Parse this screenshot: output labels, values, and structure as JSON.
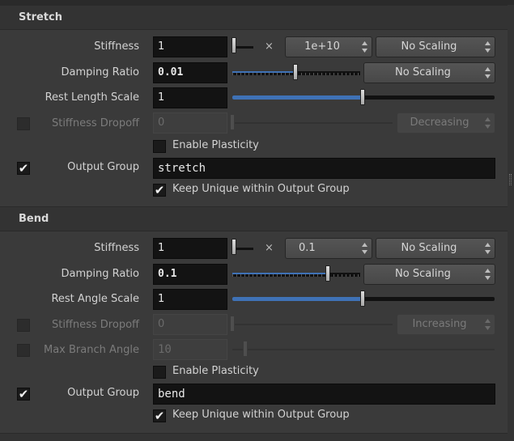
{
  "stretch": {
    "title": "Stretch",
    "stiffness": {
      "label": "Stiffness",
      "value": "1",
      "multiplier_symbol": "×",
      "exponent": "1e+10",
      "scaling": "No Scaling"
    },
    "damping_ratio": {
      "label": "Damping Ratio",
      "value": "0.01",
      "scaling": "No Scaling"
    },
    "rest_length_scale": {
      "label": "Rest Length Scale",
      "value": "1"
    },
    "stiffness_dropoff": {
      "label": "Stiffness Dropoff",
      "value": "0",
      "mode": "Decreasing",
      "enabled": false
    },
    "enable_plasticity": {
      "label": "Enable Plasticity",
      "checked": false
    },
    "output_group": {
      "label": "Output Group",
      "value": "stretch",
      "checked": true
    },
    "keep_unique": {
      "label": "Keep Unique within Output Group",
      "checked": true
    }
  },
  "bend": {
    "title": "Bend",
    "stiffness": {
      "label": "Stiffness",
      "value": "1",
      "multiplier_symbol": "×",
      "exponent": "0.1",
      "scaling": "No Scaling"
    },
    "damping_ratio": {
      "label": "Damping Ratio",
      "value": "0.1",
      "scaling": "No Scaling"
    },
    "rest_angle_scale": {
      "label": "Rest Angle Scale",
      "value": "1"
    },
    "stiffness_dropoff": {
      "label": "Stiffness Dropoff",
      "value": "0",
      "mode": "Increasing",
      "enabled": false
    },
    "max_branch_angle": {
      "label": "Max Branch Angle",
      "value": "10",
      "enabled": false
    },
    "enable_plasticity": {
      "label": "Enable Plasticity",
      "checked": false
    },
    "output_group": {
      "label": "Output Group",
      "value": "bend",
      "checked": true
    },
    "keep_unique": {
      "label": "Keep Unique within Output Group",
      "checked": true
    }
  },
  "icons": {
    "checkmark": "✔",
    "dropdown_arrows": "up-down-arrows-icon"
  },
  "colors": {
    "panel_bg": "#3a3a3a",
    "field_bg": "#131313",
    "slider_fill": "#3f72b6"
  },
  "sliders": {
    "stretch_stiffness": 0.02,
    "stretch_damping": 0.5,
    "stretch_rest_length": 0.5,
    "bend_stiffness": 0.02,
    "bend_damping": 0.75,
    "bend_rest_angle": 0.5
  }
}
